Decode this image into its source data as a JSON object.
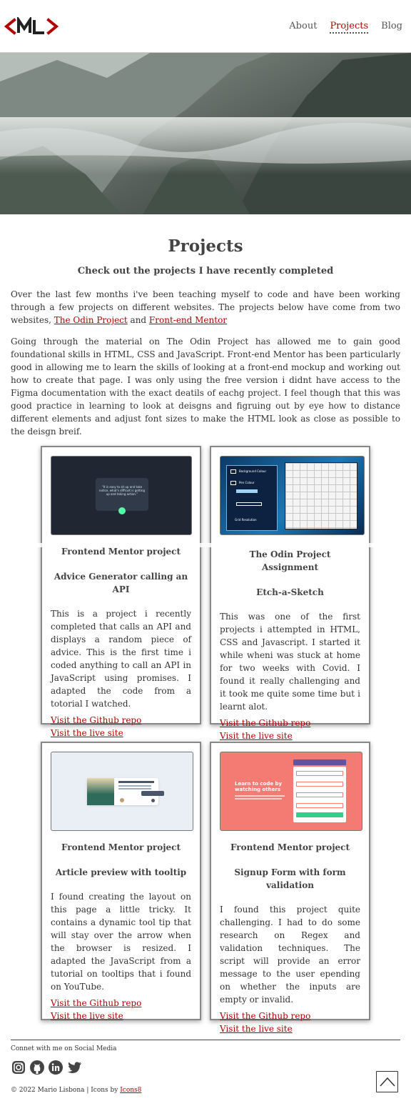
{
  "header": {
    "logo_text": "<ML>",
    "nav": [
      {
        "label": "About"
      },
      {
        "label": "Projects"
      },
      {
        "label": "Blog"
      }
    ]
  },
  "main": {
    "title": "Projects",
    "subtitle": "Check out the projects I have recently completed",
    "intro_p1_text": "Over the last few months i've been teaching myself to code and have been working through a few projects on different websites. The projects below have come from two websites, ",
    "intro_link_odin": "The Odin Project",
    "intro_and": " and ",
    "intro_link_fem": "Front-end Mentor",
    "intro_p2": "Going through the material on The Odin Project has allowed me to gain good foundational skills in HTML, CSS and JavaScript. Front-end Mentor has been particularly good in allowing me to learn the skills of looking at a front-end mockup and working out how to create that page. I was only using the free version i didnt have access to the Figma documentation with the exact deatils of eachg project. I feel though that this was good practice in learning to look at deisgns and figruing out by eye how to distance different elements and adjust font sizes to make the HTML look as close as possible to the deisgn breif."
  },
  "projects": [
    {
      "kicker": "Frontend Mentor project",
      "title": "Advice Generator calling an API",
      "body": "This is a project i recently completed that calls an API and displays a random piece of advice. This is the first time i coded anything to call an API in JavaScript using promises. I adapted the code from a totorial I watched.",
      "link_repo": "Visit the Github repo",
      "link_live": "Visit the live site",
      "thumb_text": "“It is easy to sit up and take notice, what's difficult is getting up and taking action.”"
    },
    {
      "kicker": "The Odin Project Assignment",
      "title": "Etch-a-Sketch",
      "body": "This was one of the first projects i attempted in HTML, CSS and Javascript. I started it while wheni was stuck at home for two weeks with Covid. I found it really challenging and it took me quite some time but i learnt alot.",
      "link_repo": "Visit the Github repo",
      "link_live": "Visit the live site",
      "thumb_labels": [
        "Background Colour",
        "Pen Colour",
        "Grid Resolution"
      ]
    },
    {
      "kicker": "Frontend Mentor project",
      "title": "Article preview with tooltip",
      "body": "I found creating the layout on this page a little tricky. It contains a dynamic tool tip that will stay over the arrow when the browser is resized. I adapted the JavaScript from a tutorial on tooltips that i found on YouTube.",
      "link_repo": "Visit the Github repo",
      "link_live": "Visit the live site"
    },
    {
      "kicker": "Frontend Mentor project",
      "title": "Signup Form with form validation",
      "body": "I found this project quite challenging. I had to do some research on Regex and validation techniques. The script will provide an error message to the user epending on whether the inputs are empty or invalid.",
      "link_repo": "Visit the Github repo",
      "link_live": "Visit the live site",
      "thumb_heading": "Learn to code by watching others"
    }
  ],
  "footer": {
    "heading": "Connet with me on Social Media",
    "social": [
      "instagram-icon",
      "github-icon",
      "linkedin-icon",
      "twitter-icon"
    ],
    "copyright_prefix": "© 2022 Mario Lisbona | Icons by ",
    "copyright_link": "Icons8"
  },
  "colors": {
    "accent": "#b30000",
    "text": "#333333"
  }
}
